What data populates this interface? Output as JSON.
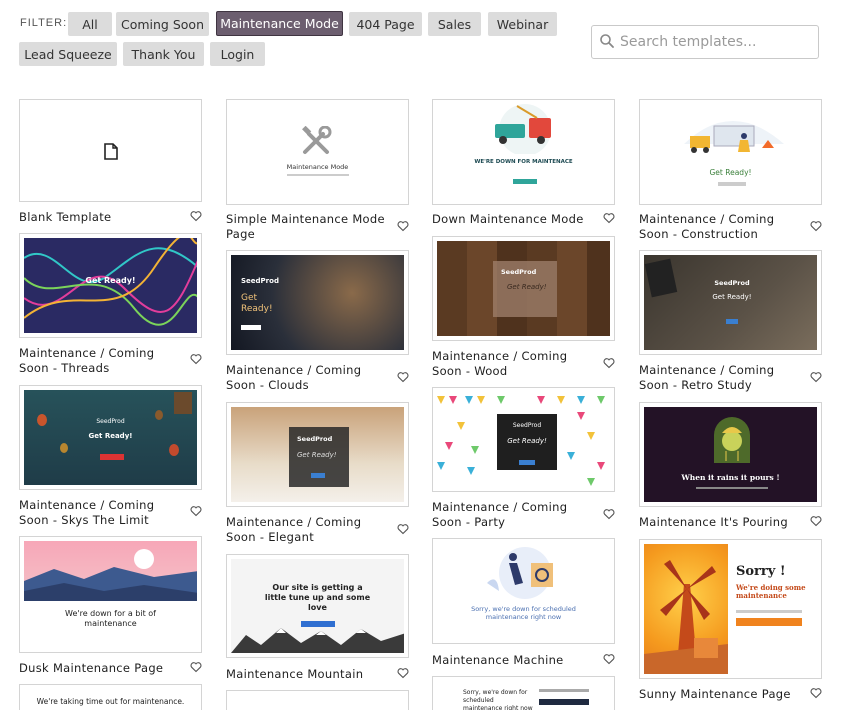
{
  "filter": {
    "label": "FILTER:",
    "chips": [
      "All",
      "Coming Soon",
      "Maintenance Mode",
      "404 Page",
      "Sales",
      "Webinar",
      "Lead Squeeze",
      "Thank You",
      "Login"
    ],
    "active": "Maintenance Mode"
  },
  "search": {
    "placeholder": "Search templates..."
  },
  "cards": [
    {
      "title": "Blank Template"
    },
    {
      "title": "Simple Maintenance Mode Page",
      "thumb_text": "Maintenance Mode"
    },
    {
      "title": "Down Maintenance Mode",
      "thumb_text": "WE'RE DOWN FOR MAINTENACE"
    },
    {
      "title": "Maintenance / Coming Soon - Construction",
      "thumb_text": "Get Ready!"
    },
    {
      "title": "Maintenance / Coming Soon - Threads",
      "thumb_text": "Get Ready!"
    },
    {
      "title": "Maintenance / Coming Soon - Clouds",
      "thumb_brand": "SeedProd",
      "thumb_text": "Get Ready!"
    },
    {
      "title": "Maintenance / Coming Soon - Wood",
      "thumb_brand": "SeedProd",
      "thumb_text": "Get Ready!"
    },
    {
      "title": "Maintenance / Coming Soon - Retro Study",
      "thumb_brand": "SeedProd",
      "thumb_text": "Get Ready!"
    },
    {
      "title": "Maintenance / Coming Soon - Skys The Limit",
      "thumb_brand": "SeedProd",
      "thumb_text": "Get Ready!"
    },
    {
      "title": "Maintenance / Coming Soon - Elegant",
      "thumb_brand": "SeedProd",
      "thumb_text": "Get Ready!"
    },
    {
      "title": "Maintenance / Coming Soon - Party",
      "thumb_brand": "SeedProd",
      "thumb_text": "Get Ready!"
    },
    {
      "title": "Maintenance It's Pouring",
      "thumb_text": "When it rains it pours !"
    },
    {
      "title": "Dusk Maintenance Page",
      "thumb_text": "We're down for a bit of maintenance"
    },
    {
      "title": "Maintenance Mountain",
      "thumb_text": "Our site is getting a little tune up and some love"
    },
    {
      "title": "Maintenance Machine",
      "thumb_text": "Sorry, we're down for scheduled maintenance right now"
    },
    {
      "title": "Sunny Maintenance Page",
      "thumb_text": "Sorry !",
      "thumb_sub": "We're doing some maintenance"
    },
    {
      "thumb_text": "We're taking time out for maintenance."
    },
    {
      "thumb_text": "Sorry, we're down for scheduled maintenance right now"
    }
  ],
  "colors": {
    "active_chip": "#6c5e6f",
    "chip": "#dcdcdc",
    "accent_orange": "#f0831e"
  },
  "icons": {
    "search": "search-icon",
    "favorite": "heart-icon",
    "blank": "file-icon"
  }
}
